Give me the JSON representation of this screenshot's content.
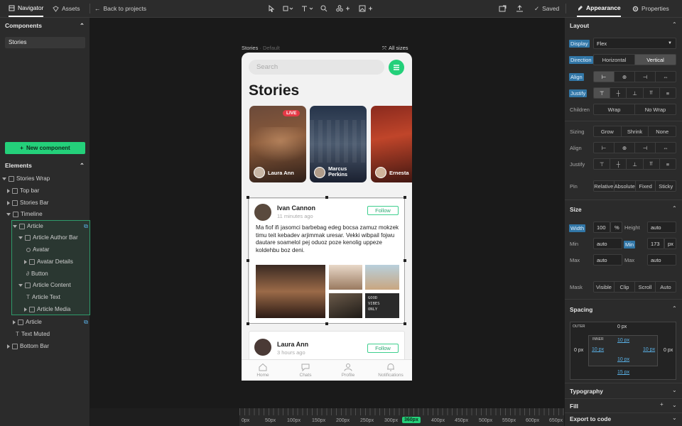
{
  "topbar": {
    "tabs": [
      "Navigator",
      "Assets"
    ],
    "back": "Back to projects",
    "saved": "Saved",
    "right_tabs": [
      "Appearance",
      "Properties"
    ]
  },
  "left": {
    "components_title": "Components",
    "components": [
      "Stories"
    ],
    "new_component": "New component",
    "elements_title": "Elements",
    "tree": [
      "Stories Wrap",
      "Top bar",
      "Stories Bar",
      "Timeline",
      "Article",
      "Article Author Bar",
      "Avatar",
      "Avatar Details",
      "Button",
      "Article Content",
      "Article Text",
      "Article Media",
      "Article",
      "Text Muted",
      "Bottom Bar"
    ]
  },
  "canvas": {
    "frame_name": "Stories",
    "frame_sub": "· Default",
    "all_sizes": "All sizes"
  },
  "phone": {
    "search_placeholder": "Search",
    "title": "Stories",
    "stories": [
      {
        "name": "Laura Ann",
        "live": "LIVE"
      },
      {
        "name": "Marcus Perkins"
      },
      {
        "name": "Ernesta"
      }
    ],
    "posts": [
      {
        "author": "Ivan Cannon",
        "time": "11 minutes ago",
        "follow": "Follow",
        "text": "Ma fiof ifi jasomci barbebag edeg bocsa zamuz mokzek timu teit kebadev arjimmak uresar. Vekki wibpail fojwu dautare soamelol pej oduoz poze kenolig uppeze koldehbu boz deni.",
        "image_caption": "GOOD VIBES ONLY"
      },
      {
        "author": "Laura Ann",
        "time": "3 hours ago",
        "follow": "Follow"
      }
    ],
    "nav": [
      "Home",
      "Chats",
      "Profile",
      "Notifications"
    ]
  },
  "ruler": {
    "labels": [
      "0px",
      "50px",
      "100px",
      "150px",
      "200px",
      "250px",
      "300px",
      "360px",
      "400px",
      "450px",
      "500px",
      "550px",
      "600px",
      "650px"
    ],
    "active": "360px"
  },
  "right": {
    "layout_title": "Layout",
    "display_label": "Display",
    "display_value": "Flex",
    "direction_label": "Direction",
    "direction_options": [
      "Horizontal",
      "Vertical"
    ],
    "align_label": "Align",
    "justify_label": "Justify",
    "children_label": "Children",
    "children_options": [
      "Wrap",
      "No Wrap"
    ],
    "sizing_label": "Sizing",
    "sizing_options": [
      "Grow",
      "Shrink",
      "None"
    ],
    "align2_label": "Align",
    "justify2_label": "Justify",
    "pin_label": "Pin",
    "pin_options": [
      "Relative",
      "Absolute",
      "Fixed",
      "Sticky"
    ],
    "size_title": "Size",
    "width_label": "Width",
    "width_value": "100",
    "width_unit": "%",
    "height_label": "Height",
    "height_value": "auto",
    "min_label": "Min",
    "min_w": "auto",
    "min_h_label": "Min",
    "min_h": "173",
    "min_h_unit": "px",
    "max_label": "Max",
    "max_w": "auto",
    "max_h_label": "Max",
    "max_h": "auto",
    "mask_label": "Mask",
    "mask_options": [
      "Visible",
      "Clip",
      "Scroll",
      "Auto"
    ],
    "spacing_title": "Spacing",
    "outer": "OUTER",
    "inner": "INNER",
    "outer_top": "0 px",
    "outer_left": "0 px",
    "outer_right": "0 px",
    "outer_bottom": "15 px",
    "inner_top": "10 px",
    "inner_left": "10 px",
    "inner_right": "10 px",
    "inner_bottom": "10 px",
    "typography_title": "Typography",
    "fill_title": "Fill",
    "export_title": "Export to code"
  },
  "colors": {
    "accent": "#24d07a",
    "live": "#e63946",
    "selection": "#3a8f6c"
  }
}
